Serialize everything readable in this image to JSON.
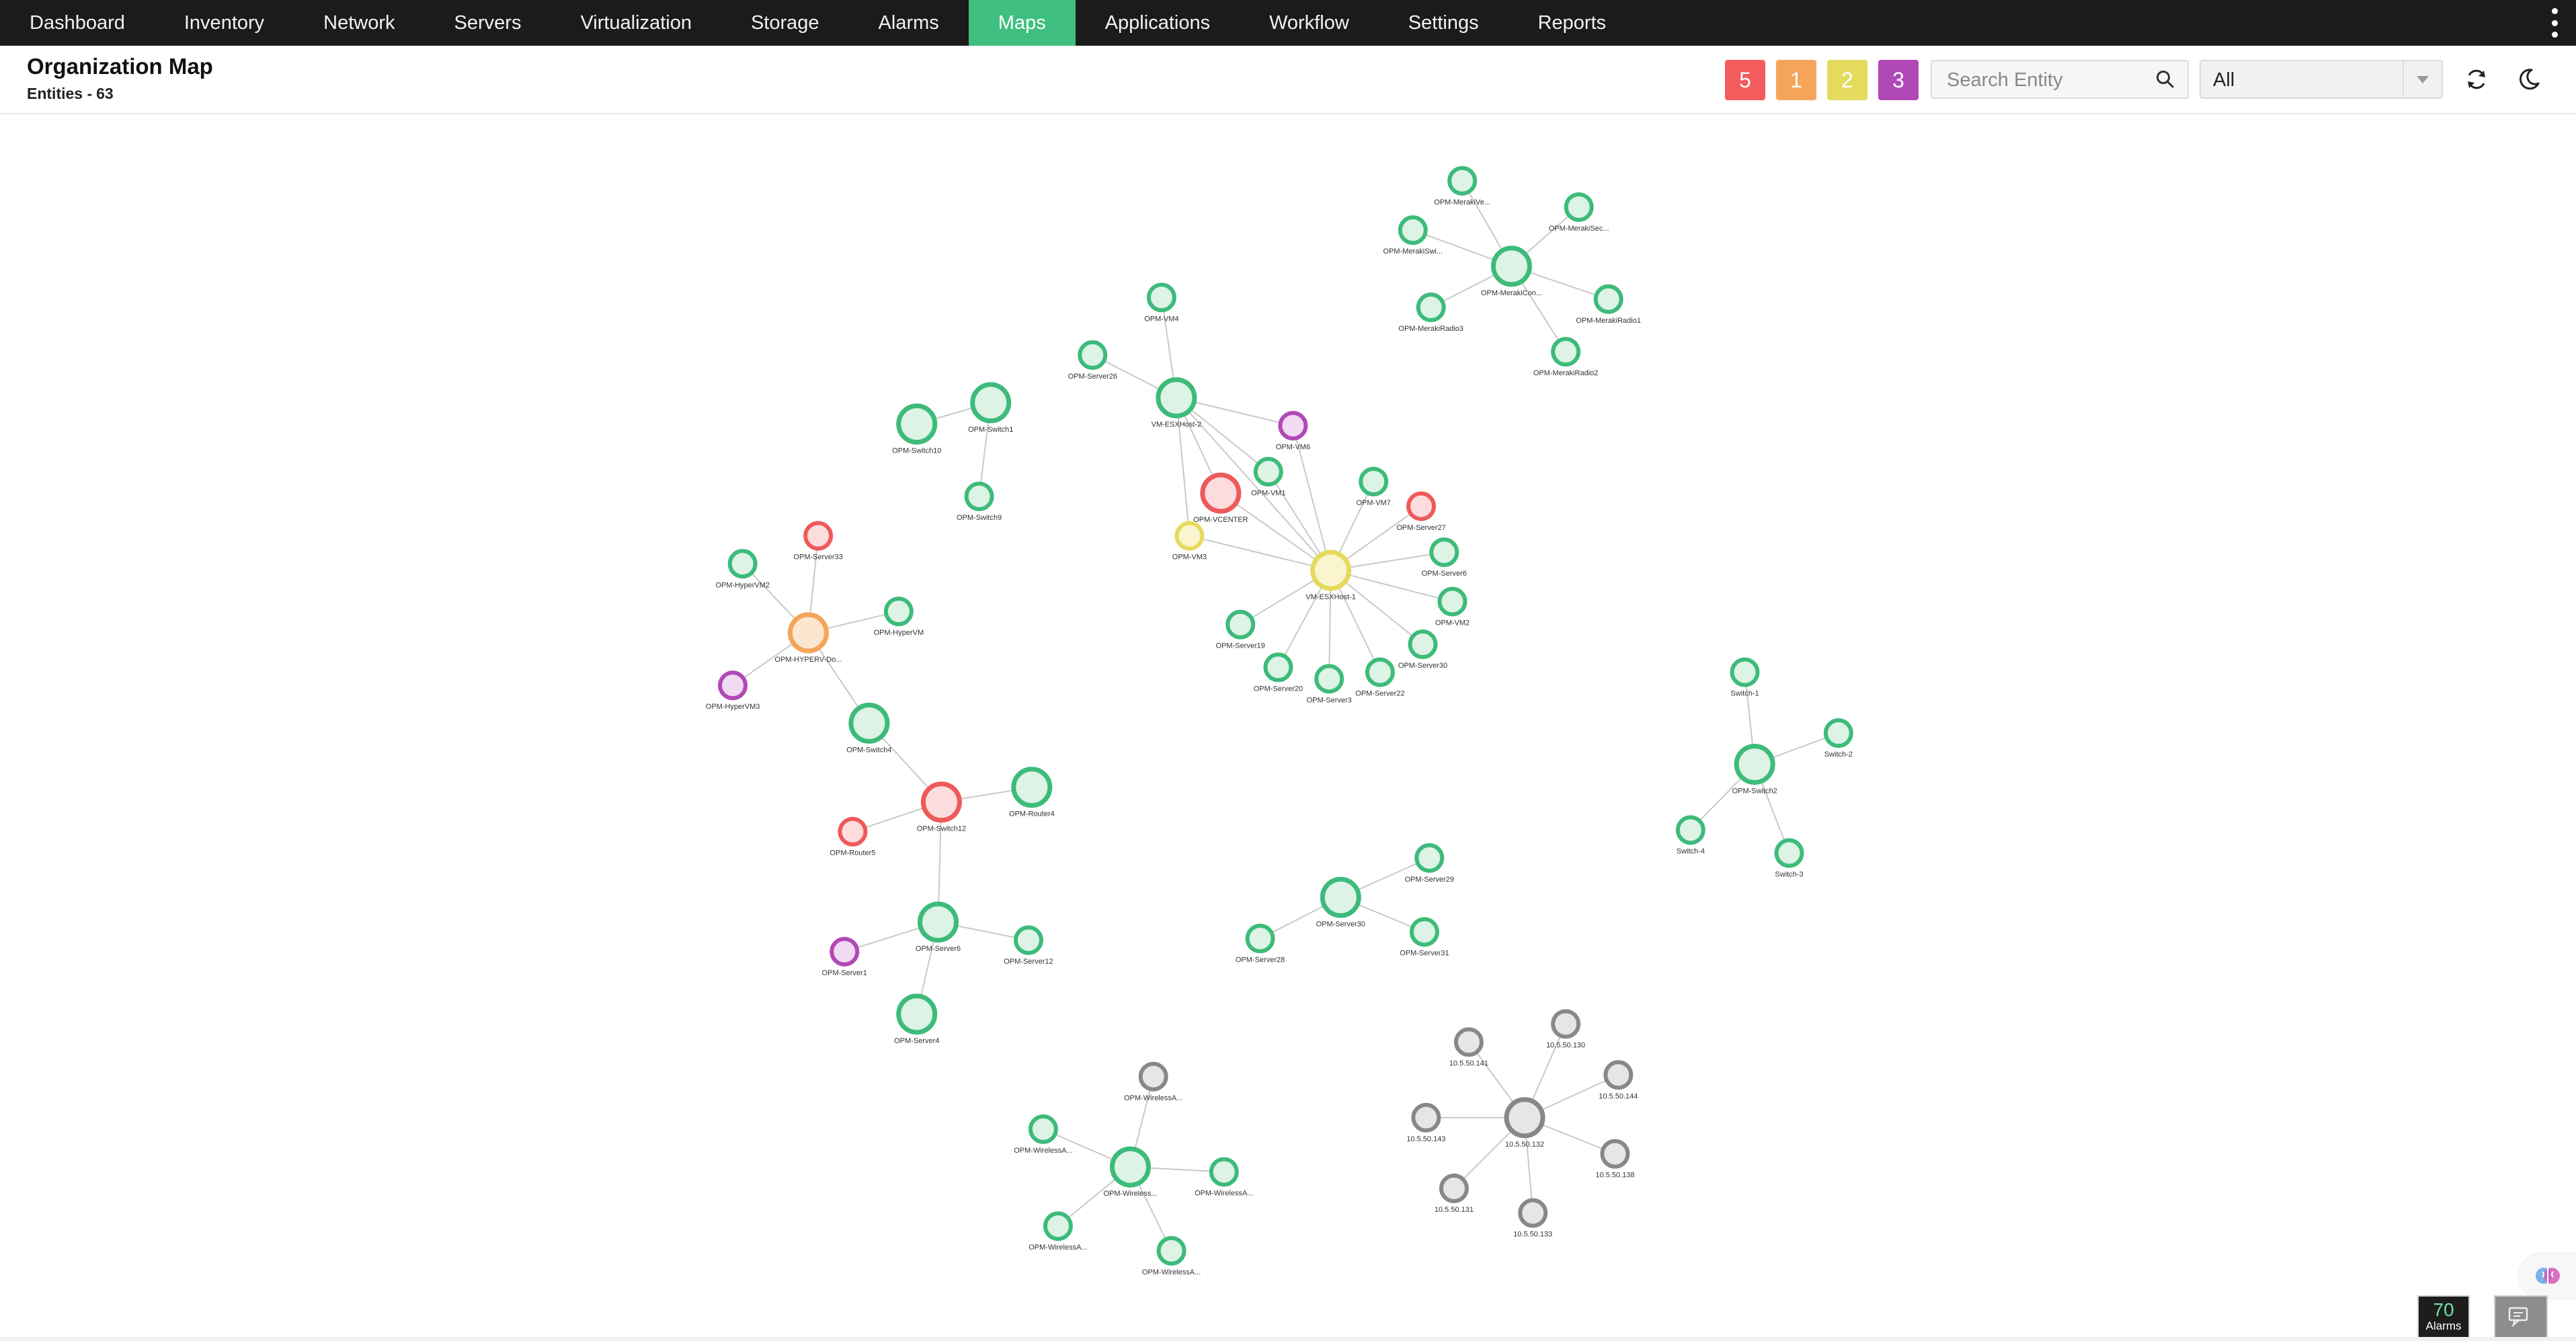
{
  "nav": {
    "items": [
      {
        "label": "Dashboard",
        "active": false
      },
      {
        "label": "Inventory",
        "active": false
      },
      {
        "label": "Network",
        "active": false
      },
      {
        "label": "Servers",
        "active": false
      },
      {
        "label": "Virtualization",
        "active": false
      },
      {
        "label": "Storage",
        "active": false
      },
      {
        "label": "Alarms",
        "active": false
      },
      {
        "label": "Maps",
        "active": true
      },
      {
        "label": "Applications",
        "active": false
      },
      {
        "label": "Workflow",
        "active": false
      },
      {
        "label": "Settings",
        "active": false
      },
      {
        "label": "Reports",
        "active": false
      }
    ],
    "more_icon": "vertical-ellipsis-icon"
  },
  "header": {
    "title": "Organization Map",
    "entities_label": "Entities -",
    "entities_count": "63"
  },
  "severity": [
    {
      "count": "5",
      "color": "#f25c5c",
      "name": "critical"
    },
    {
      "count": "1",
      "color": "#f5a55a",
      "name": "major"
    },
    {
      "count": "2",
      "color": "#e3da5e",
      "name": "minor"
    },
    {
      "count": "3",
      "color": "#b049b6",
      "name": "warning"
    }
  ],
  "search": {
    "placeholder": "Search Entity",
    "value": "",
    "icon": "search-icon"
  },
  "filter": {
    "selected": "All"
  },
  "toolbar": {
    "refresh_icon": "refresh-icon",
    "theme_icon": "moon-icon"
  },
  "colors": {
    "clear_stroke": "#3dbb7a",
    "clear_fill": "#dcf3e6",
    "critical_stroke": "#ee5a5a",
    "critical_fill": "#fcdcdc",
    "major_stroke": "#f3a55a",
    "major_fill": "#fde6cf",
    "minor_stroke": "#e6da5e",
    "minor_fill": "#faf5cf",
    "warning_stroke": "#b049b6",
    "warning_fill": "#f1dbf3",
    "unknown_stroke": "#888888",
    "unknown_fill": "#e6e6e6",
    "edge": "#c9c9c9"
  },
  "map": {
    "nodes": [
      {
        "id": "m1",
        "label": "OPM-MerakiCon...",
        "status": "clear"
      },
      {
        "id": "m2",
        "label": "OPM-MerakiVe...",
        "status": "clear"
      },
      {
        "id": "m3",
        "label": "OPM-MerakiSec...",
        "status": "clear"
      },
      {
        "id": "m4",
        "label": "OPM-MerakiSwi...",
        "status": "clear"
      },
      {
        "id": "m5",
        "label": "OPM-MerakiRadio1",
        "status": "clear"
      },
      {
        "id": "m6",
        "label": "OPM-MerakiRadio3",
        "status": "clear"
      },
      {
        "id": "m7",
        "label": "OPM-MerakiRadio2",
        "status": "clear"
      },
      {
        "id": "e2",
        "label": "VM-ESXHost-2",
        "status": "clear"
      },
      {
        "id": "vm4",
        "label": "OPM-VM4",
        "status": "clear"
      },
      {
        "id": "s26",
        "label": "OPM-Server26",
        "status": "clear"
      },
      {
        "id": "vm6",
        "label": "OPM-VM6",
        "status": "warning"
      },
      {
        "id": "vc",
        "label": "OPM-VCENTER",
        "status": "critical"
      },
      {
        "id": "vm1",
        "label": "OPM-VM1",
        "status": "clear"
      },
      {
        "id": "vm3",
        "label": "OPM-VM3",
        "status": "minor"
      },
      {
        "id": "e1",
        "label": "VM-ESXHost-1",
        "status": "minor"
      },
      {
        "id": "vm7",
        "label": "OPM-VM7",
        "status": "clear"
      },
      {
        "id": "s27",
        "label": "OPM-Server27",
        "status": "critical"
      },
      {
        "id": "s6",
        "label": "OPM-Server6",
        "status": "clear"
      },
      {
        "id": "vm2",
        "label": "OPM-VM2",
        "status": "clear"
      },
      {
        "id": "s30b",
        "label": "OPM-Server30",
        "status": "clear"
      },
      {
        "id": "s22",
        "label": "OPM-Server22",
        "status": "clear"
      },
      {
        "id": "s3",
        "label": "OPM-Server3",
        "status": "clear"
      },
      {
        "id": "s20",
        "label": "OPM-Server20",
        "status": "clear"
      },
      {
        "id": "s19",
        "label": "OPM-Server19",
        "status": "clear"
      },
      {
        "id": "sw10",
        "label": "OPM-Switch10",
        "status": "clear"
      },
      {
        "id": "sw1",
        "label": "OPM-Switch1",
        "status": "clear"
      },
      {
        "id": "sw9",
        "label": "OPM-Switch9",
        "status": "clear"
      },
      {
        "id": "hv",
        "label": "OPM-HYPERV-Do...",
        "status": "major"
      },
      {
        "id": "s33",
        "label": "OPM-Server33",
        "status": "critical"
      },
      {
        "id": "hvm2",
        "label": "OPM-HyperVM2",
        "status": "clear"
      },
      {
        "id": "hvm",
        "label": "OPM-HyperVM",
        "status": "clear"
      },
      {
        "id": "hvm3",
        "label": "OPM-HyperVM3",
        "status": "warning"
      },
      {
        "id": "sw4",
        "label": "OPM-Switch4",
        "status": "clear"
      },
      {
        "id": "sw12",
        "label": "OPM-Switch12",
        "status": "critical"
      },
      {
        "id": "r4",
        "label": "OPM-Router4",
        "status": "clear"
      },
      {
        "id": "r5",
        "label": "OPM-Router5",
        "status": "critical"
      },
      {
        "id": "s6b",
        "label": "OPM-Server6",
        "status": "clear"
      },
      {
        "id": "s1",
        "label": "OPM-Server1",
        "status": "warning"
      },
      {
        "id": "s12",
        "label": "OPM-Server12",
        "status": "clear"
      },
      {
        "id": "s4",
        "label": "OPM-Server4",
        "status": "clear"
      },
      {
        "id": "sw2c",
        "label": "OPM-Switch2",
        "status": "clear"
      },
      {
        "id": "sw_1",
        "label": "Switch-1",
        "status": "clear"
      },
      {
        "id": "sw_2",
        "label": "Switch-2",
        "status": "clear"
      },
      {
        "id": "sw_4",
        "label": "Switch-4",
        "status": "clear"
      },
      {
        "id": "sw_3",
        "label": "Switch-3",
        "status": "clear"
      },
      {
        "id": "s30",
        "label": "OPM-Server30",
        "status": "clear"
      },
      {
        "id": "s29",
        "label": "OPM-Server29",
        "status": "clear"
      },
      {
        "id": "s28",
        "label": "OPM-Server28",
        "status": "clear"
      },
      {
        "id": "s31",
        "label": "OPM-Server31",
        "status": "clear"
      },
      {
        "id": "w0",
        "label": "OPM-Wireless...",
        "status": "clear"
      },
      {
        "id": "w1",
        "label": "OPM-WirelessA...",
        "status": "unknown"
      },
      {
        "id": "w2",
        "label": "OPM-WirelessA...",
        "status": "clear"
      },
      {
        "id": "w3",
        "label": "OPM-WirelessA...",
        "status": "clear"
      },
      {
        "id": "w4",
        "label": "OPM-WirelessA...",
        "status": "clear"
      },
      {
        "id": "w5",
        "label": "OPM-WirelessA...",
        "status": "clear"
      },
      {
        "id": "ip0",
        "label": "10.5.50.132",
        "status": "unknown"
      },
      {
        "id": "ip1",
        "label": "10.5.50.141",
        "status": "unknown"
      },
      {
        "id": "ip2",
        "label": "10.5.50.130",
        "status": "unknown"
      },
      {
        "id": "ip3",
        "label": "10.5.50.144",
        "status": "unknown"
      },
      {
        "id": "ip4",
        "label": "10.5.50.143",
        "status": "unknown"
      },
      {
        "id": "ip5",
        "label": "10.5.50.138",
        "status": "unknown"
      },
      {
        "id": "ip6",
        "label": "10.5.50.131",
        "status": "unknown"
      },
      {
        "id": "ip7",
        "label": "10.5.50.133",
        "status": "unknown"
      }
    ],
    "edges": [
      [
        "m1",
        "m2"
      ],
      [
        "m1",
        "m3"
      ],
      [
        "m1",
        "m4"
      ],
      [
        "m1",
        "m5"
      ],
      [
        "m1",
        "m6"
      ],
      [
        "m1",
        "m7"
      ],
      [
        "e2",
        "vm4"
      ],
      [
        "e2",
        "s26"
      ],
      [
        "e2",
        "vm6"
      ],
      [
        "e2",
        "vc"
      ],
      [
        "e2",
        "vm1"
      ],
      [
        "e2",
        "vm3"
      ],
      [
        "e2",
        "e1"
      ],
      [
        "e1",
        "vc"
      ],
      [
        "e1",
        "vm1"
      ],
      [
        "e1",
        "vm3"
      ],
      [
        "e1",
        "vm6"
      ],
      [
        "e1",
        "vm7"
      ],
      [
        "e1",
        "s27"
      ],
      [
        "e1",
        "s6"
      ],
      [
        "e1",
        "vm2"
      ],
      [
        "e1",
        "s30b"
      ],
      [
        "e1",
        "s22"
      ],
      [
        "e1",
        "s3"
      ],
      [
        "e1",
        "s20"
      ],
      [
        "e1",
        "s19"
      ],
      [
        "sw10",
        "sw1"
      ],
      [
        "sw1",
        "sw9"
      ],
      [
        "hv",
        "s33"
      ],
      [
        "hv",
        "hvm2"
      ],
      [
        "hv",
        "hvm"
      ],
      [
        "hv",
        "hvm3"
      ],
      [
        "hv",
        "sw4"
      ],
      [
        "sw4",
        "sw12"
      ],
      [
        "sw12",
        "r4"
      ],
      [
        "sw12",
        "r5"
      ],
      [
        "sw12",
        "s6b"
      ],
      [
        "s6b",
        "s1"
      ],
      [
        "s6b",
        "s12"
      ],
      [
        "s6b",
        "s4"
      ],
      [
        "sw2c",
        "sw_1"
      ],
      [
        "sw2c",
        "sw_2"
      ],
      [
        "sw2c",
        "sw_4"
      ],
      [
        "sw2c",
        "sw_3"
      ],
      [
        "s30",
        "s29"
      ],
      [
        "s30",
        "s28"
      ],
      [
        "s30",
        "s31"
      ],
      [
        "w0",
        "w1"
      ],
      [
        "w0",
        "w2"
      ],
      [
        "w0",
        "w3"
      ],
      [
        "w0",
        "w4"
      ],
      [
        "w0",
        "w5"
      ],
      [
        "ip0",
        "ip1"
      ],
      [
        "ip0",
        "ip2"
      ],
      [
        "ip0",
        "ip3"
      ],
      [
        "ip0",
        "ip4"
      ],
      [
        "ip0",
        "ip5"
      ],
      [
        "ip0",
        "ip6"
      ],
      [
        "ip0",
        "ip7"
      ]
    ]
  },
  "alarms_widget": {
    "count": "70",
    "label": "Alarms"
  },
  "chat_icon": "chat-icon",
  "ai_icon": "brain-icon"
}
